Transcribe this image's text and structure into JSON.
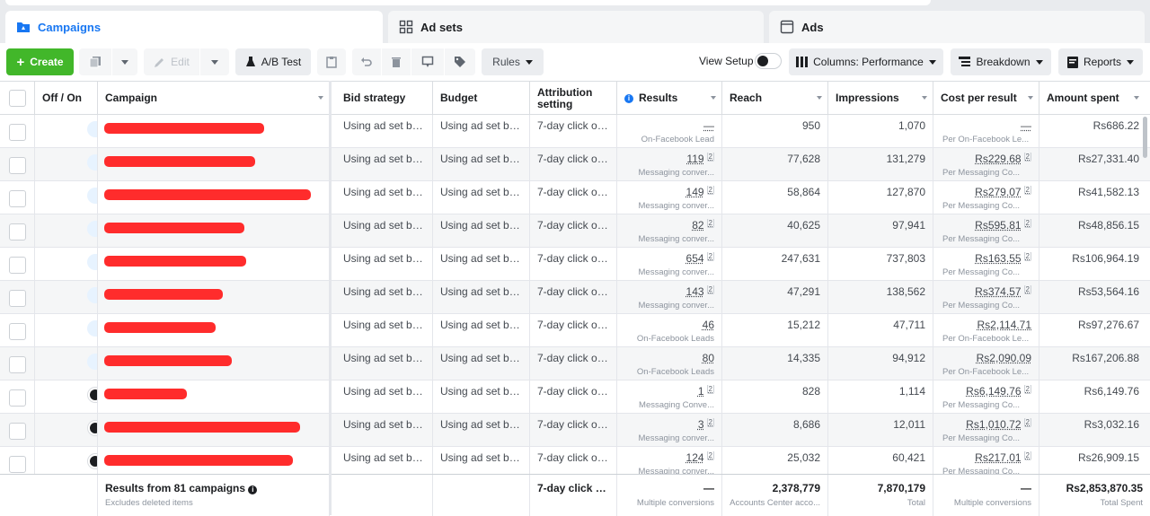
{
  "tabs": [
    {
      "label": "Campaigns",
      "active": true
    },
    {
      "label": "Ad sets",
      "active": false
    },
    {
      "label": "Ads",
      "active": false
    }
  ],
  "toolbar": {
    "create": "Create",
    "edit": "Edit",
    "ab_test": "A/B Test",
    "rules": "Rules",
    "view_setup": "View Setup",
    "columns": "Columns: Performance",
    "breakdown": "Breakdown",
    "reports": "Reports"
  },
  "columns": {
    "off_on": "Off / On",
    "campaign": "Campaign",
    "bid_strategy": "Bid strategy",
    "budget": "Budget",
    "attribution": "Attribution setting",
    "results": "Results",
    "reach": "Reach",
    "impressions": "Impressions",
    "cost_per_result": "Cost per result",
    "amount_spent": "Amount spent"
  },
  "rows": [
    {
      "on": true,
      "bid": "Using ad set bid...",
      "budget": "Using ad set bu...",
      "attribution": "7-day click or ...",
      "results": "—",
      "results_sub": "On-Facebook Lead",
      "results_flag": false,
      "reach": "950",
      "impressions": "1,070",
      "cpr": "—",
      "cpr_sub": "Per On-Facebook Le...",
      "cpr_flag": false,
      "spent": "Rs686.22"
    },
    {
      "on": true,
      "bid": "Using ad set bid...",
      "budget": "Using ad set bu...",
      "attribution": "7-day click or ...",
      "results": "119",
      "results_sub": "Messaging conver...",
      "results_flag": true,
      "reach": "77,628",
      "impressions": "131,279",
      "cpr": "Rs229.68",
      "cpr_sub": "Per Messaging Co...",
      "cpr_flag": true,
      "spent": "Rs27,331.40"
    },
    {
      "on": true,
      "bid": "Using ad set bid...",
      "budget": "Using ad set bu...",
      "attribution": "7-day click or ...",
      "results": "149",
      "results_sub": "Messaging conver...",
      "results_flag": true,
      "reach": "58,864",
      "impressions": "127,870",
      "cpr": "Rs279.07",
      "cpr_sub": "Per Messaging Co...",
      "cpr_flag": true,
      "spent": "Rs41,582.13"
    },
    {
      "on": true,
      "bid": "Using ad set bid...",
      "budget": "Using ad set bu...",
      "attribution": "7-day click or ...",
      "results": "82",
      "results_sub": "Messaging conver...",
      "results_flag": true,
      "reach": "40,625",
      "impressions": "97,941",
      "cpr": "Rs595.81",
      "cpr_sub": "Per Messaging Co...",
      "cpr_flag": true,
      "spent": "Rs48,856.15"
    },
    {
      "on": true,
      "bid": "Using ad set bid...",
      "budget": "Using ad set bu...",
      "attribution": "7-day click or ...",
      "results": "654",
      "results_sub": "Messaging conver...",
      "results_flag": true,
      "reach": "247,631",
      "impressions": "737,803",
      "cpr": "Rs163.55",
      "cpr_sub": "Per Messaging Co...",
      "cpr_flag": true,
      "spent": "Rs106,964.19"
    },
    {
      "on": true,
      "bid": "Using ad set bid...",
      "budget": "Using ad set bu...",
      "attribution": "7-day click or ...",
      "results": "143",
      "results_sub": "Messaging conver...",
      "results_flag": true,
      "reach": "47,291",
      "impressions": "138,562",
      "cpr": "Rs374.57",
      "cpr_sub": "Per Messaging Co...",
      "cpr_flag": true,
      "spent": "Rs53,564.16"
    },
    {
      "on": true,
      "bid": "Using ad set bid...",
      "budget": "Using ad set bu...",
      "attribution": "7-day click or ...",
      "results": "46",
      "results_sub": "On-Facebook Leads",
      "results_flag": false,
      "reach": "15,212",
      "impressions": "47,711",
      "cpr": "Rs2,114.71",
      "cpr_sub": "Per On-Facebook Le...",
      "cpr_flag": false,
      "spent": "Rs97,276.67"
    },
    {
      "on": true,
      "bid": "Using ad set bid...",
      "budget": "Using ad set bu...",
      "attribution": "7-day click or ...",
      "results": "80",
      "results_sub": "On-Facebook Leads",
      "results_flag": false,
      "reach": "14,335",
      "impressions": "94,912",
      "cpr": "Rs2,090.09",
      "cpr_sub": "Per On-Facebook Le...",
      "cpr_flag": false,
      "spent": "Rs167,206.88"
    },
    {
      "on": false,
      "bid": "Using ad set bid...",
      "budget": "Using ad set bu...",
      "attribution": "7-day click or ...",
      "results": "1",
      "results_sub": "Messaging Conve...",
      "results_flag": true,
      "reach": "828",
      "impressions": "1,114",
      "cpr": "Rs6,149.76",
      "cpr_sub": "Per Messaging Co...",
      "cpr_flag": true,
      "spent": "Rs6,149.76"
    },
    {
      "on": false,
      "bid": "Using ad set bid...",
      "budget": "Using ad set bu...",
      "attribution": "7-day click or ...",
      "results": "3",
      "results_sub": "Messaging conver...",
      "results_flag": true,
      "reach": "8,686",
      "impressions": "12,011",
      "cpr": "Rs1,010.72",
      "cpr_sub": "Per Messaging Co...",
      "cpr_flag": true,
      "spent": "Rs3,032.16"
    },
    {
      "on": false,
      "bid": "Using ad set bid...",
      "budget": "Using ad set bu...",
      "attribution": "7-day click or ...",
      "results": "124",
      "results_sub": "Messaging conver...",
      "results_flag": true,
      "reach": "25,032",
      "impressions": "60,421",
      "cpr": "Rs217.01",
      "cpr_sub": "Per Messaging Co...",
      "cpr_flag": true,
      "spent": "Rs26,909.15"
    }
  ],
  "footer": {
    "title": "Results from 81 campaigns",
    "subtitle": "Excludes deleted items",
    "attribution": "7-day click or ...",
    "results": "—",
    "results_sub": "Multiple conversions",
    "reach": "2,378,779",
    "reach_sub": "Accounts Center acco...",
    "impressions": "7,870,179",
    "impressions_sub": "Total",
    "cpr": "—",
    "cpr_sub": "Multiple conversions",
    "spent": "Rs2,853,870.35",
    "spent_sub": "Total Spent"
  },
  "colors": {
    "accent": "#1877f2",
    "create": "#42b72a",
    "redaction": "#ff1a1a"
  }
}
